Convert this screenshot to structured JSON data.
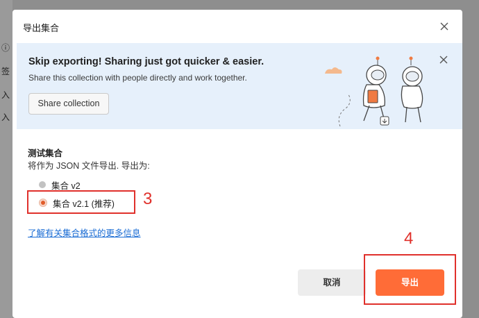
{
  "background": {
    "glyphs": [
      "ⓘ",
      "签",
      "入",
      "入"
    ]
  },
  "modal": {
    "title": "导出集合"
  },
  "banner": {
    "title": "Skip exporting! Sharing just got quicker & easier.",
    "description": "Share this collection with people directly and work together.",
    "share_button": "Share collection"
  },
  "collection": {
    "name": "测试集合",
    "description": "将作为 JSON 文件导出. 导出为:"
  },
  "format_options": [
    {
      "label": "集合 v2",
      "selected": false
    },
    {
      "label": "集合 v2.1 (推荐)",
      "selected": true
    }
  ],
  "learn_more_link": "了解有关集合格式的更多信息",
  "actions": {
    "cancel": "取消",
    "export": "导出"
  },
  "annotations": {
    "step_3": "3",
    "step_4": "4"
  },
  "colors": {
    "accent": "#ff6c37",
    "banner_bg": "#e6f0fb",
    "annotation": "#e0302b",
    "link": "#1a6cd4"
  }
}
